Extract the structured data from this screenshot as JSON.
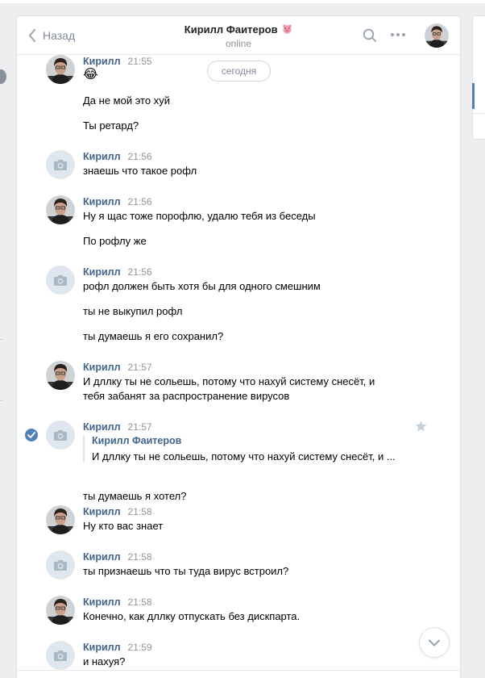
{
  "header": {
    "back_label": "Назад",
    "peer_name": "Кирилл Фаитеров",
    "peer_status": "online"
  },
  "date_separator": "сегодня",
  "messages": [
    {
      "author": "Кирилл",
      "time": "21:55",
      "avatar": "photo",
      "lines": [
        "😂",
        "Да не мой это хуй",
        "Ты ретард?"
      ]
    },
    {
      "author": "Кирилл",
      "time": "21:56",
      "avatar": "camera",
      "lines": [
        "знаешь что такое рофл"
      ]
    },
    {
      "author": "Кирилл",
      "time": "21:56",
      "avatar": "photo",
      "lines": [
        "Ну я щас тоже порофлю, удалю тебя из беседы",
        "По рофлу же"
      ]
    },
    {
      "author": "Кирилл",
      "time": "21:56",
      "avatar": "camera",
      "lines": [
        "рофл должен быть хотя бы для одного смешним",
        "ты не выкупил рофл",
        "ты думаешь я его сохранил?"
      ]
    },
    {
      "author": "Кирилл",
      "time": "21:57",
      "avatar": "photo",
      "lines": [
        "И дллку ты не сольешь, потому что нахуй систему снесёт, и",
        "тебя забанят за распространение вирусов"
      ]
    },
    {
      "author": "Кирилл",
      "time": "21:57",
      "avatar": "camera",
      "selected": true,
      "forwarded": {
        "author": "Кирилл Фаитеров",
        "text": "И дллку ты не сольешь, потому что нахуй систему снесёт, и ..."
      },
      "lines": [
        "ты думаешь я хотел?"
      ]
    },
    {
      "author": "Кирилл",
      "time": "21:58",
      "avatar": "photo",
      "lines": [
        "Ну кто вас знает"
      ]
    },
    {
      "author": "Кирилл",
      "time": "21:58",
      "avatar": "camera",
      "lines": [
        "ты признаешь что ты туда вирус встроил?"
      ]
    },
    {
      "author": "Кирилл",
      "time": "21:58",
      "avatar": "photo",
      "lines": [
        "Конечно, как дллку отпускать без дискпарта."
      ]
    },
    {
      "author": "Кирилл",
      "time": "21:59",
      "avatar": "camera",
      "lines": [
        "и нахуя?"
      ]
    }
  ],
  "colors": {
    "accent": "#5181b8",
    "author": "#42648b",
    "background": "#edeef0"
  },
  "icons": {
    "back": "chevron-left-icon",
    "search": "search-icon",
    "more": "more-dots-icon",
    "camera": "camera-icon",
    "check": "check-icon",
    "star": "star-icon",
    "scroll": "chevron-down-icon"
  }
}
